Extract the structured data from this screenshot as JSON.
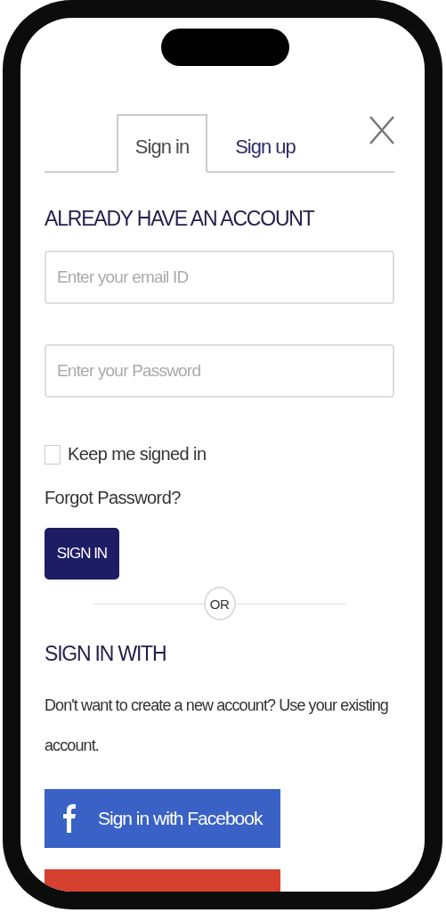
{
  "tabs": [
    {
      "label": "Sign in",
      "selected": true
    },
    {
      "label": "Sign up",
      "selected": false
    }
  ],
  "heading": "ALREADY HAVE AN ACCOUNT",
  "email": {
    "placeholder": "Enter your email ID"
  },
  "password": {
    "placeholder": "Enter your Password"
  },
  "keep_signed_in": {
    "label": "Keep me signed in",
    "checked": false
  },
  "forgot_link": "Forgot Password?",
  "sign_in_button": "SIGN IN",
  "divider_label": "OR",
  "social_heading": "SIGN IN WITH",
  "description": "Don't want to create a new account? Use your existing account.",
  "social_buttons": [
    {
      "kind": "facebook",
      "label": "Sign in with Facebook",
      "color": "#3a62c6"
    },
    {
      "kind": "other",
      "color": "#d5402f"
    }
  ]
}
